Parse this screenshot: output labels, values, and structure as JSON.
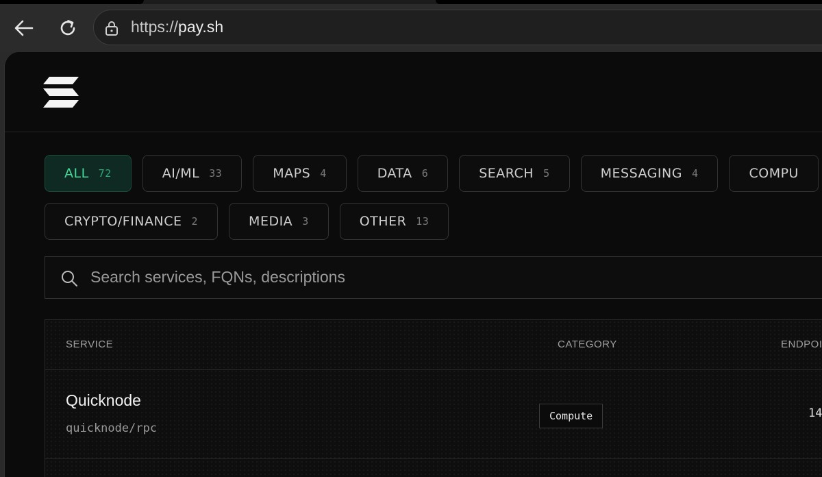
{
  "browser": {
    "url_scheme": "https://",
    "url_host": "pay.sh"
  },
  "filters": [
    {
      "label": "ALL",
      "count": "72",
      "active": true
    },
    {
      "label": "AI/ML",
      "count": "33"
    },
    {
      "label": "MAPS",
      "count": "4"
    },
    {
      "label": "DATA",
      "count": "6"
    },
    {
      "label": "SEARCH",
      "count": "5"
    },
    {
      "label": "MESSAGING",
      "count": "4"
    },
    {
      "label": "COMPU",
      "count": ""
    },
    {
      "label": "CRYPTO/FINANCE",
      "count": "2"
    },
    {
      "label": "MEDIA",
      "count": "3"
    },
    {
      "label": "OTHER",
      "count": "13"
    }
  ],
  "search": {
    "placeholder": "Search services, FQNs, descriptions"
  },
  "table": {
    "headers": {
      "service": "SERVICE",
      "category": "CATEGORY",
      "endpoints": "ENDPOI"
    },
    "rows": [
      {
        "name": "Quicknode",
        "fqn": "quicknode/rpc",
        "category": "Compute",
        "endpoints": "14"
      }
    ]
  },
  "colors": {
    "accent": "#45d99a",
    "background": "#0b0b0c"
  }
}
